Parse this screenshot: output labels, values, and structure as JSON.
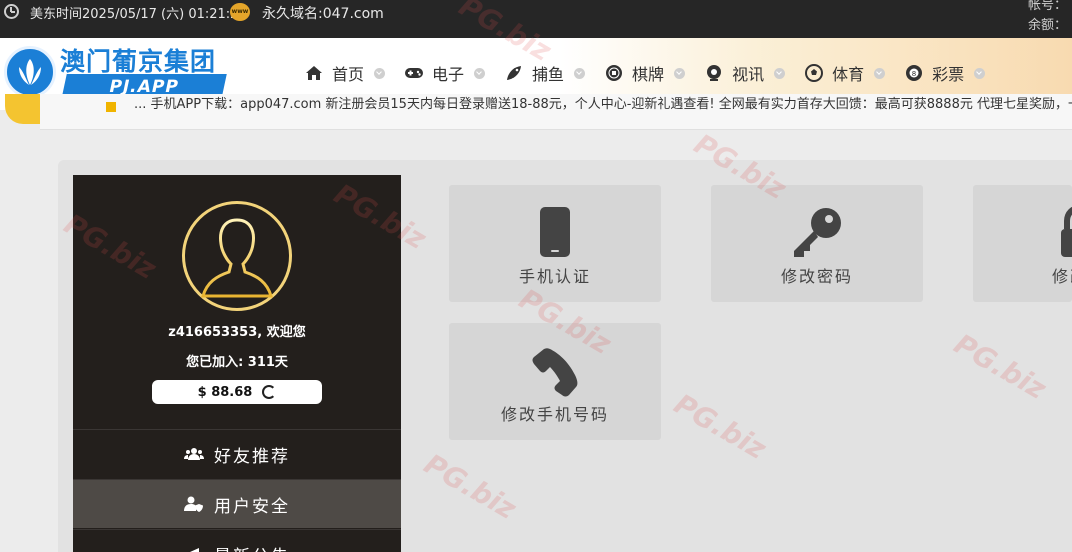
{
  "topbar": {
    "time": "美东时间2025/05/17 (六) 01:21:25",
    "domain": "永久域名:047.com",
    "account_label": "帐号：",
    "balance_label": "余额：",
    "www_badge": "www"
  },
  "header": {
    "brand_cn": "澳门葡京集团",
    "brand_app": "PJ.APP",
    "nav": [
      {
        "label": "首页",
        "icon": "home-icon"
      },
      {
        "label": "电子",
        "icon": "gamepad-icon"
      },
      {
        "label": "捕鱼",
        "icon": "fish-icon"
      },
      {
        "label": "棋牌",
        "icon": "chess-icon"
      },
      {
        "label": "视讯",
        "icon": "camera-icon"
      },
      {
        "label": "体育",
        "icon": "soccer-icon"
      },
      {
        "label": "彩票",
        "icon": "lottery-ball-icon"
      }
    ]
  },
  "marquee": {
    "text": "... 手机APP下载：app047.com    新注册会员15天内每日登录赠送18-88元，个人中心-迎新礼遇查看!    全网最有实力首存大回馈：最高可获8888元    代理七星奖励，一次..."
  },
  "user": {
    "greeting": "z416653353, 欢迎您",
    "joined": "您已加入: 311天",
    "balance": "$ 88.68"
  },
  "menu": [
    {
      "label": "好友推荐",
      "icon": "users-icon",
      "active": false
    },
    {
      "label": "用户安全",
      "icon": "user-shield-icon",
      "active": true
    },
    {
      "label": "最新公告",
      "icon": "megaphone-icon",
      "active": false
    }
  ],
  "cards": [
    {
      "label": "手机认证",
      "icon": "mobile-phone-icon"
    },
    {
      "label": "修改密码",
      "icon": "key-icon"
    },
    {
      "label": "修改取",
      "icon": "lock-icon"
    },
    {
      "label": "修改手机号码",
      "icon": "phone-handset-icon"
    }
  ],
  "watermark": "PG.biz"
}
